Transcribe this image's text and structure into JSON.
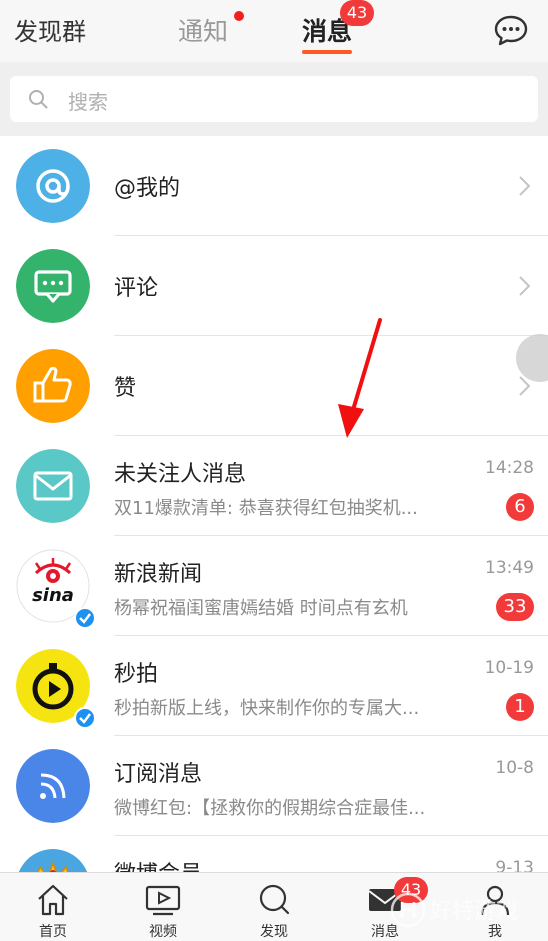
{
  "header": {
    "left_label": "发现群",
    "tabs": [
      {
        "label": "通知",
        "has_dot": true
      },
      {
        "label": "消息",
        "badge": "43",
        "selected": true
      }
    ],
    "right_icon": "chat-bubble-icon"
  },
  "search": {
    "placeholder": "搜索"
  },
  "messages": [
    {
      "title": "@我的",
      "icon": "at-icon",
      "color": "#4db0e6"
    },
    {
      "title": "评论",
      "icon": "comment-icon",
      "color": "#33b36b"
    },
    {
      "title": "赞",
      "icon": "thumbs-up-icon",
      "color": "#ff9f00"
    },
    {
      "title": "未关注人消息",
      "subtitle": "双11爆款清单: 恭喜获得红包抽奖机...",
      "time": "14:28",
      "count": "6",
      "icon": "envelope-icon",
      "color": "#5bc8c8"
    },
    {
      "title": "新浪新闻",
      "subtitle": "杨幂祝福闺蜜唐嫣结婚 时间点有玄机",
      "time": "13:49",
      "count": "33",
      "logo": "sina"
    },
    {
      "title": "秒拍",
      "subtitle": "秒拍新版上线，快来制作你的专属大...",
      "time": "10-19",
      "count": "1",
      "icon": "play-stopwatch-icon",
      "color": "#f5e40f"
    },
    {
      "title": "订阅消息",
      "subtitle": "微博红包:【拯救你的假期综合症最佳...",
      "time": "10-8",
      "icon": "rss-icon",
      "color": "#4a86e8"
    },
    {
      "title": "微博会员",
      "time": "9-13",
      "icon": "crown-icon"
    }
  ],
  "tabbar": {
    "items": [
      {
        "label": "首页",
        "icon": "home-icon"
      },
      {
        "label": "视频",
        "icon": "video-icon"
      },
      {
        "label": "发现",
        "icon": "search-icon"
      },
      {
        "label": "消息",
        "icon": "mail-icon",
        "badge": "43"
      },
      {
        "label": "我",
        "icon": "profile-icon"
      }
    ]
  },
  "watermark": "好特游戏"
}
